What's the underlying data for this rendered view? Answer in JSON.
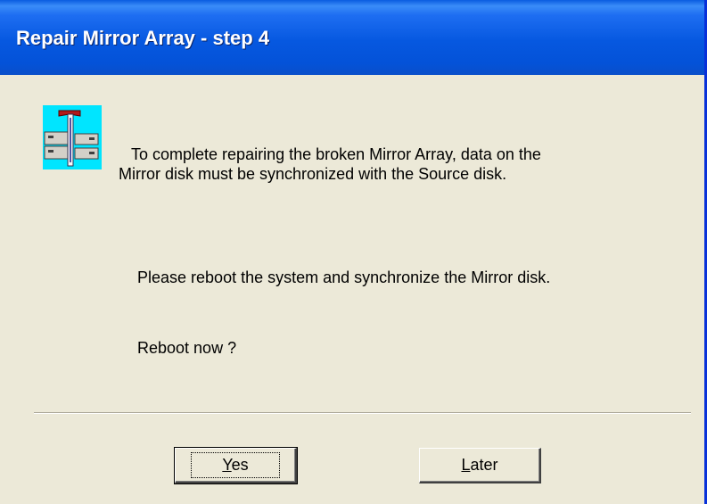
{
  "window": {
    "title": "Repair Mirror Array - step 4",
    "icon": "mirror-disk-repair-icon"
  },
  "message": {
    "line1": "To complete repairing the broken Mirror Array, data on the",
    "line2": "Mirror disk must be synchronized with the Source disk.",
    "instruction": "Please reboot the system and synchronize the Mirror disk.",
    "question": "Reboot now ?"
  },
  "buttons": {
    "yes": {
      "accel": "Y",
      "rest": "es"
    },
    "later": {
      "accel": "L",
      "rest": "ater"
    }
  },
  "colors": {
    "titlebar": "#0658e0",
    "dialog_bg": "#ece9d8",
    "icon_bg": "#00e5ff"
  }
}
